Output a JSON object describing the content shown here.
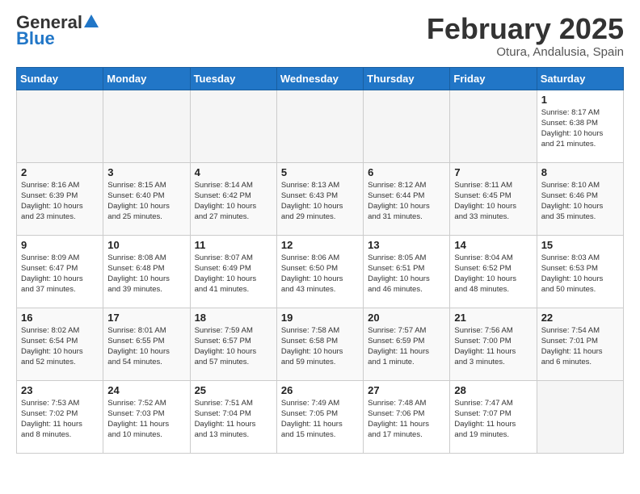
{
  "header": {
    "logo_general": "General",
    "logo_blue": "Blue",
    "month_title": "February 2025",
    "location": "Otura, Andalusia, Spain"
  },
  "weekdays": [
    "Sunday",
    "Monday",
    "Tuesday",
    "Wednesday",
    "Thursday",
    "Friday",
    "Saturday"
  ],
  "weeks": [
    [
      {
        "day": "",
        "info": ""
      },
      {
        "day": "",
        "info": ""
      },
      {
        "day": "",
        "info": ""
      },
      {
        "day": "",
        "info": ""
      },
      {
        "day": "",
        "info": ""
      },
      {
        "day": "",
        "info": ""
      },
      {
        "day": "1",
        "info": "Sunrise: 8:17 AM\nSunset: 6:38 PM\nDaylight: 10 hours\nand 21 minutes."
      }
    ],
    [
      {
        "day": "2",
        "info": "Sunrise: 8:16 AM\nSunset: 6:39 PM\nDaylight: 10 hours\nand 23 minutes."
      },
      {
        "day": "3",
        "info": "Sunrise: 8:15 AM\nSunset: 6:40 PM\nDaylight: 10 hours\nand 25 minutes."
      },
      {
        "day": "4",
        "info": "Sunrise: 8:14 AM\nSunset: 6:42 PM\nDaylight: 10 hours\nand 27 minutes."
      },
      {
        "day": "5",
        "info": "Sunrise: 8:13 AM\nSunset: 6:43 PM\nDaylight: 10 hours\nand 29 minutes."
      },
      {
        "day": "6",
        "info": "Sunrise: 8:12 AM\nSunset: 6:44 PM\nDaylight: 10 hours\nand 31 minutes."
      },
      {
        "day": "7",
        "info": "Sunrise: 8:11 AM\nSunset: 6:45 PM\nDaylight: 10 hours\nand 33 minutes."
      },
      {
        "day": "8",
        "info": "Sunrise: 8:10 AM\nSunset: 6:46 PM\nDaylight: 10 hours\nand 35 minutes."
      }
    ],
    [
      {
        "day": "9",
        "info": "Sunrise: 8:09 AM\nSunset: 6:47 PM\nDaylight: 10 hours\nand 37 minutes."
      },
      {
        "day": "10",
        "info": "Sunrise: 8:08 AM\nSunset: 6:48 PM\nDaylight: 10 hours\nand 39 minutes."
      },
      {
        "day": "11",
        "info": "Sunrise: 8:07 AM\nSunset: 6:49 PM\nDaylight: 10 hours\nand 41 minutes."
      },
      {
        "day": "12",
        "info": "Sunrise: 8:06 AM\nSunset: 6:50 PM\nDaylight: 10 hours\nand 43 minutes."
      },
      {
        "day": "13",
        "info": "Sunrise: 8:05 AM\nSunset: 6:51 PM\nDaylight: 10 hours\nand 46 minutes."
      },
      {
        "day": "14",
        "info": "Sunrise: 8:04 AM\nSunset: 6:52 PM\nDaylight: 10 hours\nand 48 minutes."
      },
      {
        "day": "15",
        "info": "Sunrise: 8:03 AM\nSunset: 6:53 PM\nDaylight: 10 hours\nand 50 minutes."
      }
    ],
    [
      {
        "day": "16",
        "info": "Sunrise: 8:02 AM\nSunset: 6:54 PM\nDaylight: 10 hours\nand 52 minutes."
      },
      {
        "day": "17",
        "info": "Sunrise: 8:01 AM\nSunset: 6:55 PM\nDaylight: 10 hours\nand 54 minutes."
      },
      {
        "day": "18",
        "info": "Sunrise: 7:59 AM\nSunset: 6:57 PM\nDaylight: 10 hours\nand 57 minutes."
      },
      {
        "day": "19",
        "info": "Sunrise: 7:58 AM\nSunset: 6:58 PM\nDaylight: 10 hours\nand 59 minutes."
      },
      {
        "day": "20",
        "info": "Sunrise: 7:57 AM\nSunset: 6:59 PM\nDaylight: 11 hours\nand 1 minute."
      },
      {
        "day": "21",
        "info": "Sunrise: 7:56 AM\nSunset: 7:00 PM\nDaylight: 11 hours\nand 3 minutes."
      },
      {
        "day": "22",
        "info": "Sunrise: 7:54 AM\nSunset: 7:01 PM\nDaylight: 11 hours\nand 6 minutes."
      }
    ],
    [
      {
        "day": "23",
        "info": "Sunrise: 7:53 AM\nSunset: 7:02 PM\nDaylight: 11 hours\nand 8 minutes."
      },
      {
        "day": "24",
        "info": "Sunrise: 7:52 AM\nSunset: 7:03 PM\nDaylight: 11 hours\nand 10 minutes."
      },
      {
        "day": "25",
        "info": "Sunrise: 7:51 AM\nSunset: 7:04 PM\nDaylight: 11 hours\nand 13 minutes."
      },
      {
        "day": "26",
        "info": "Sunrise: 7:49 AM\nSunset: 7:05 PM\nDaylight: 11 hours\nand 15 minutes."
      },
      {
        "day": "27",
        "info": "Sunrise: 7:48 AM\nSunset: 7:06 PM\nDaylight: 11 hours\nand 17 minutes."
      },
      {
        "day": "28",
        "info": "Sunrise: 7:47 AM\nSunset: 7:07 PM\nDaylight: 11 hours\nand 19 minutes."
      },
      {
        "day": "",
        "info": ""
      }
    ]
  ]
}
